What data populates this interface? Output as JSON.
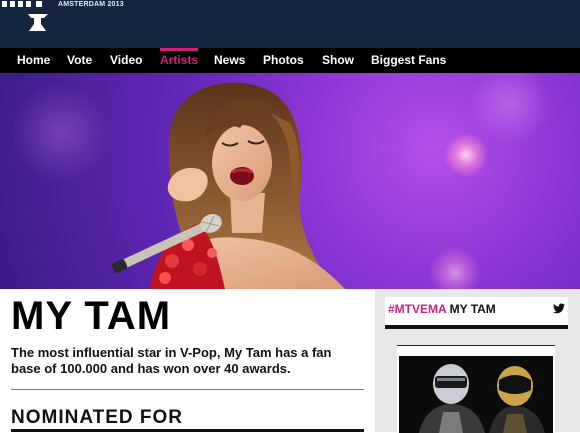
{
  "header": {
    "logo_text": "MTV",
    "event_text": "AMSTERDAM 2013"
  },
  "nav": {
    "items": [
      {
        "label": "Home"
      },
      {
        "label": "Vote"
      },
      {
        "label": "Video"
      },
      {
        "label": "Artists",
        "active": true
      },
      {
        "label": "News"
      },
      {
        "label": "Photos"
      },
      {
        "label": "Show"
      },
      {
        "label": "Biggest Fans"
      }
    ]
  },
  "artist": {
    "name": "MY TAM",
    "bio": "The most influential star in V-Pop, My Tam has a fan base of 100.000 and has won over 40 awards.",
    "nominated_heading": "NOMINATED FOR"
  },
  "sidebar": {
    "hashtag": "#MTVEMA",
    "hashtag_name": "MY TAM",
    "social_icon": "twitter-icon"
  },
  "colors": {
    "accent": "#d21f7a",
    "header_bg": "#14273f",
    "nav_bg": "#000000",
    "hero_purple": "#7a2fd0"
  }
}
